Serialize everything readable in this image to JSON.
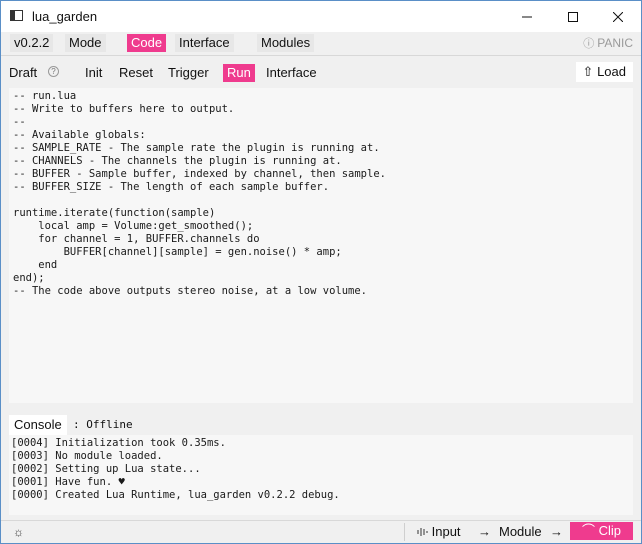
{
  "window": {
    "title": "lua_garden",
    "minimize_glyph": "–",
    "maximize_glyph": "□",
    "close_glyph": "✕"
  },
  "menu": {
    "version": "v0.2.2",
    "items": [
      {
        "label": "Mode",
        "active": false
      },
      {
        "label": "Code",
        "active": true
      },
      {
        "label": "Interface",
        "active": false
      },
      {
        "label": "Modules",
        "active": false
      }
    ],
    "panic_icon": "ⓘ",
    "panic_label": "PANIC"
  },
  "draft": {
    "label": "Draft",
    "help_icon": "?",
    "tabs": [
      {
        "label": "Init",
        "active": false
      },
      {
        "label": "Reset",
        "active": false
      },
      {
        "label": "Trigger",
        "active": false
      },
      {
        "label": "Run",
        "active": true
      },
      {
        "label": "Interface",
        "active": false
      }
    ],
    "load_icon": "⇧",
    "load_label": "Load"
  },
  "editor": {
    "code": "-- run.lua\n-- Write to buffers here to output.\n--\n-- Available globals:\n-- SAMPLE_RATE - The sample rate the plugin is running at.\n-- CHANNELS - The channels the plugin is running at.\n-- BUFFER - Sample buffer, indexed by channel, then sample.\n-- BUFFER_SIZE - The length of each sample buffer.\n\nruntime.iterate(function(sample)\n    local amp = Volume:get_smoothed();\n    for channel = 1, BUFFER.channels do\n        BUFFER[channel][sample] = gen.noise() * amp;\n    end\nend);\n-- The code above outputs stereo noise, at a low volume."
  },
  "console": {
    "label": "Console",
    "status": ": Offline",
    "lines": [
      "[0004] Initialization took 0.35ms.",
      "[0003] No module loaded.",
      "[0002] Setting up Lua state...",
      "[0001] Have fun. ♥",
      "[0000] Created Lua Runtime, lua_garden v0.2.2 debug."
    ]
  },
  "bottom": {
    "theme_icon": "☼",
    "input_label": "Input",
    "arrow1": "→",
    "module_label": "Module",
    "arrow2": "→",
    "clip_icon": "⌒",
    "clip_label": "Clip"
  },
  "colors": {
    "accent": "#ef3b8e",
    "background": "#f0f0f0",
    "editor_bg": "#f7f7f7"
  }
}
